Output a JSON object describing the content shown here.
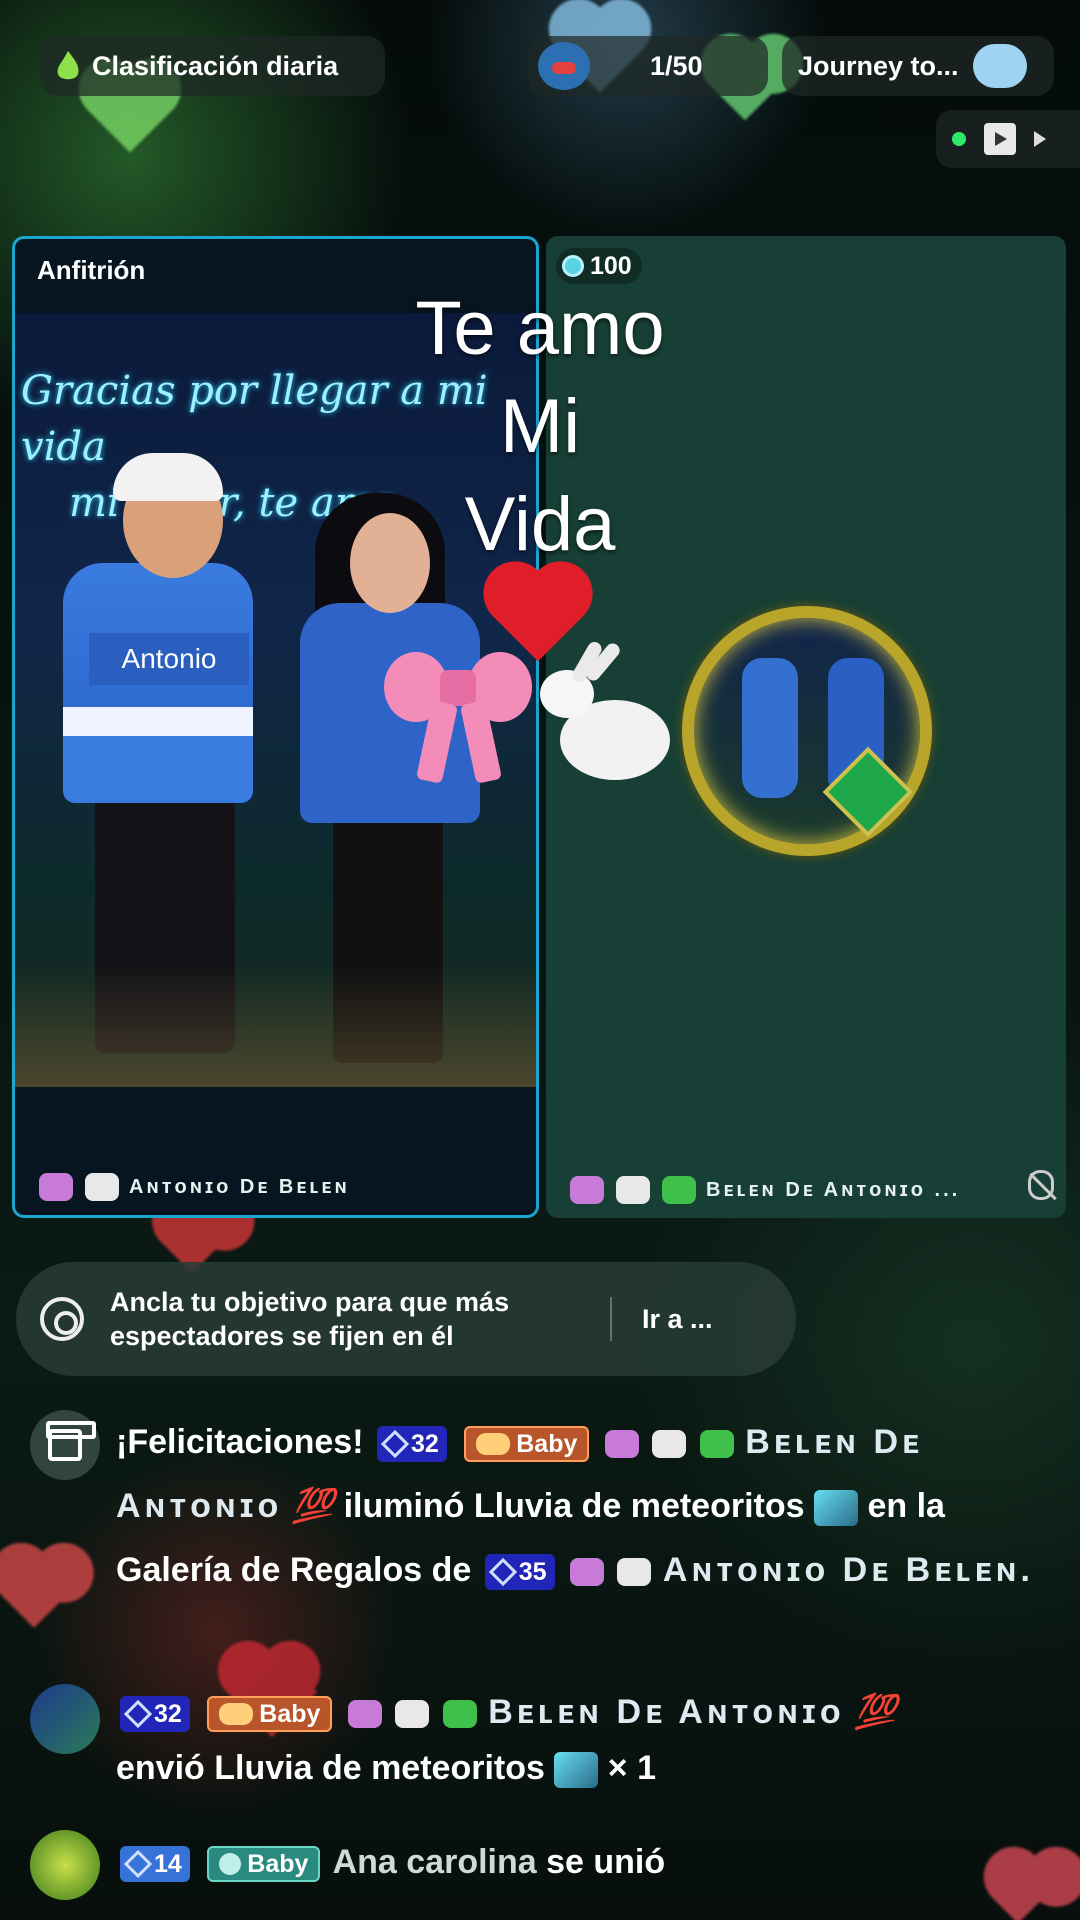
{
  "top_bar": {
    "rank_label": "Clasificación diaria",
    "count_value": "1/50",
    "journey_label": "Journey to..."
  },
  "host_panel": {
    "role_label": "Anfitrión",
    "art_caption_line1": "Gracias por llegar a mi vida",
    "art_caption_line2": "mi amor, te amo",
    "art_name_man": "Antonio",
    "name": "Aɴᴛᴏɴɪᴏ Dᴇ Bᴇʟᴇɴ"
  },
  "guest_panel": {
    "coins": "100",
    "name": "Bᴇʟᴇɴ Dᴇ Aɴᴛᴏɴɪᴏ ..."
  },
  "overlay": {
    "line1": "Te amo",
    "line2": "Mi",
    "line3": "Vida"
  },
  "goal_bar": {
    "text": "Ancla tu objetivo para que más espectadores se fijen en él",
    "link": "Ir a ..."
  },
  "chat": [
    {
      "prefix": "¡Felicitaciones!",
      "level": "32",
      "fan_badge": "Baby",
      "user": "Bᴇʟᴇɴ Dᴇ Aɴᴛᴏɴɪᴏ",
      "action": "iluminó Lluvia de meteoritos",
      "mid": "en la Galería de Regalos de",
      "level2": "35",
      "user2": "Aɴᴛᴏɴɪᴏ Dᴇ Bᴇʟᴇɴ."
    },
    {
      "level": "32",
      "fan_badge": "Baby",
      "user": "Bᴇʟᴇɴ Dᴇ Aɴᴛᴏɴɪᴏ",
      "action": "envió Lluvia de meteoritos",
      "qty": "× 1"
    },
    {
      "level": "14",
      "fan_badge": "Baby",
      "user": "Ana carolina",
      "action": "se unió"
    }
  ],
  "colors": {
    "accent_cyan": "#1aa6cf",
    "guest_bg": "#173f35",
    "level_badge": "#2226b8",
    "fan_badge": "#b8552a"
  }
}
